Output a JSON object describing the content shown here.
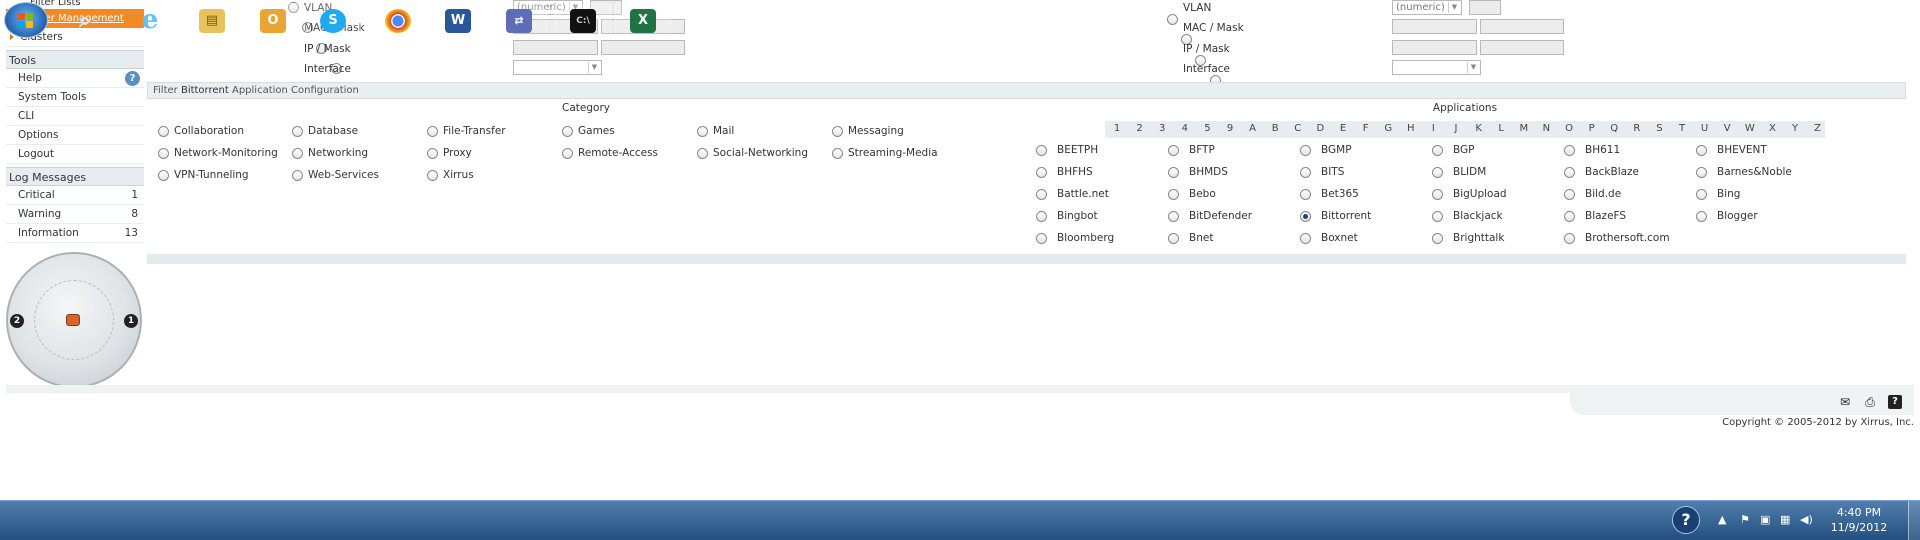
{
  "sidebar": {
    "filter_lists": "Filter Lists",
    "filter_management": "Filter Management",
    "clusters": "Clusters",
    "tools_header": "Tools",
    "tools": [
      "Help",
      "System Tools",
      "CLI",
      "Options",
      "Logout"
    ],
    "help_icon": "question-icon",
    "log_header": "Log Messages",
    "logs": [
      {
        "label": "Critical",
        "count": "1"
      },
      {
        "label": "Warning",
        "count": "8"
      },
      {
        "label": "Information",
        "count": "13"
      }
    ]
  },
  "device": {
    "port_left": "2",
    "port_right": "1"
  },
  "filter_rows": {
    "labels": [
      "VLAN",
      "MAC / Mask",
      "IP / Mask",
      "Interface"
    ],
    "vlan_select": "(numeric)"
  },
  "config": {
    "bar_prefix": "Filter ",
    "bar_name": "Bittorrent",
    "bar_suffix": " Application Configuration",
    "category_header": "Category",
    "applications_header": "Applications",
    "categories": [
      "Collaboration",
      "Database",
      "File-Transfer",
      "Games",
      "Mail",
      "Messaging",
      "Network-Monitoring",
      "Networking",
      "Proxy",
      "Remote-Access",
      "Social-Networking",
      "Streaming-Media",
      "VPN-Tunneling",
      "Web-Services",
      "Xirrus"
    ],
    "alphabet": [
      "1",
      "2",
      "3",
      "4",
      "5",
      "9",
      "A",
      "B",
      "C",
      "D",
      "E",
      "F",
      "G",
      "H",
      "I",
      "J",
      "K",
      "L",
      "M",
      "N",
      "O",
      "P",
      "Q",
      "R",
      "S",
      "T",
      "U",
      "V",
      "W",
      "X",
      "Y",
      "Z"
    ],
    "applications": [
      "BEETPH",
      "BFTP",
      "BGMP",
      "BGP",
      "BH611",
      "BHEVENT",
      "BHFHS",
      "BHMDS",
      "BITS",
      "BLIDM",
      "BackBlaze",
      "Barnes&Noble",
      "Battle.net",
      "Bebo",
      "Bet365",
      "BigUpload",
      "Bild.de",
      "Bing",
      "Bingbot",
      "BitDefender",
      "Bittorrent",
      "Blackjack",
      "BlazeFS",
      "Blogger",
      "Bloomberg",
      "Bnet",
      "Boxnet",
      "Brighttalk",
      "Brothersoft.com"
    ],
    "selected_application": "Bittorrent"
  },
  "footer": {
    "copyright": "Copyright © 2005-2012 by Xirrus, Inc.",
    "icons": [
      "mail-icon",
      "print-icon",
      "help-icon"
    ]
  },
  "taskbar": {
    "time": "4:40 PM",
    "date": "11/9/2012",
    "apps": [
      "search-magnifier-icon",
      "internet-explorer-icon",
      "file-explorer-icon",
      "outlook-icon",
      "skype-icon",
      "chrome-icon",
      "word-icon",
      "network-tool-icon",
      "command-prompt-icon",
      "excel-icon"
    ],
    "colors": {
      "taskbar": "#2f5f91",
      "accent": "#f08a24"
    }
  }
}
